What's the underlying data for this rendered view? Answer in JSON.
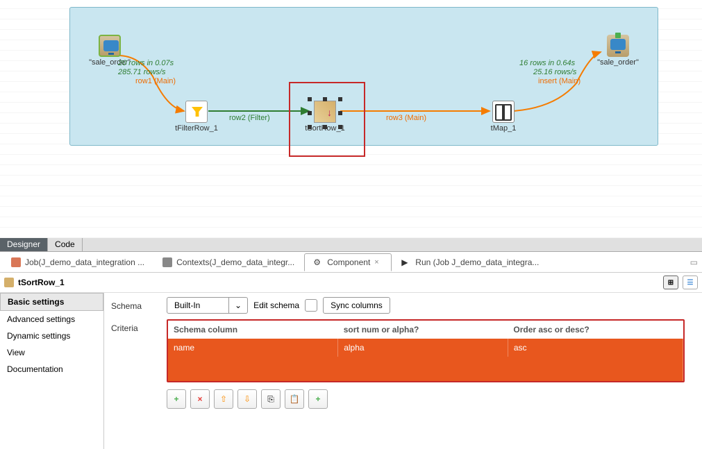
{
  "canvas": {
    "components": {
      "source": {
        "label": "\"sale_order\""
      },
      "filter": {
        "label": "tFilterRow_1"
      },
      "sort": {
        "label": "tSortRow_1"
      },
      "tmap": {
        "label": "tMap_1"
      },
      "target": {
        "label": "\"sale_order\""
      }
    },
    "flows": {
      "r1_stat1": "20 rows in 0.07s",
      "r1_stat2": "285.71 rows/s",
      "r1_label": "row1 (Main)",
      "r2_label": "row2 (Filter)",
      "r3_label": "row3 (Main)",
      "r4_stat1": "16 rows in 0.64s",
      "r4_stat2": "25.16 rows/s",
      "r4_label": "insert (Main)"
    }
  },
  "view_tabs": {
    "designer": "Designer",
    "code": "Code"
  },
  "panel_tabs": {
    "job": "Job(J_demo_data_integration ...",
    "contexts": "Contexts(J_demo_data_integr...",
    "component": "Component",
    "run": "Run (Job J_demo_data_integra..."
  },
  "config": {
    "title": "tSortRow_1",
    "nav": {
      "basic": "Basic settings",
      "advanced": "Advanced settings",
      "dynamic": "Dynamic settings",
      "view": "View",
      "doc": "Documentation"
    },
    "schema_label": "Schema",
    "schema_value": "Built-In",
    "edit_schema": "Edit schema",
    "sync_columns": "Sync columns",
    "criteria_label": "Criteria",
    "table": {
      "headers": {
        "col1": "Schema column",
        "col2": "sort num or alpha?",
        "col3": "Order asc or desc?"
      },
      "row1": {
        "col1": "name",
        "col2": "alpha",
        "col3": "asc"
      }
    },
    "toolbar_icons": {
      "add": "+",
      "remove": "×",
      "up": "⇧",
      "down": "⇩",
      "copy": "⎘",
      "paste": "📋",
      "import": "+"
    }
  }
}
